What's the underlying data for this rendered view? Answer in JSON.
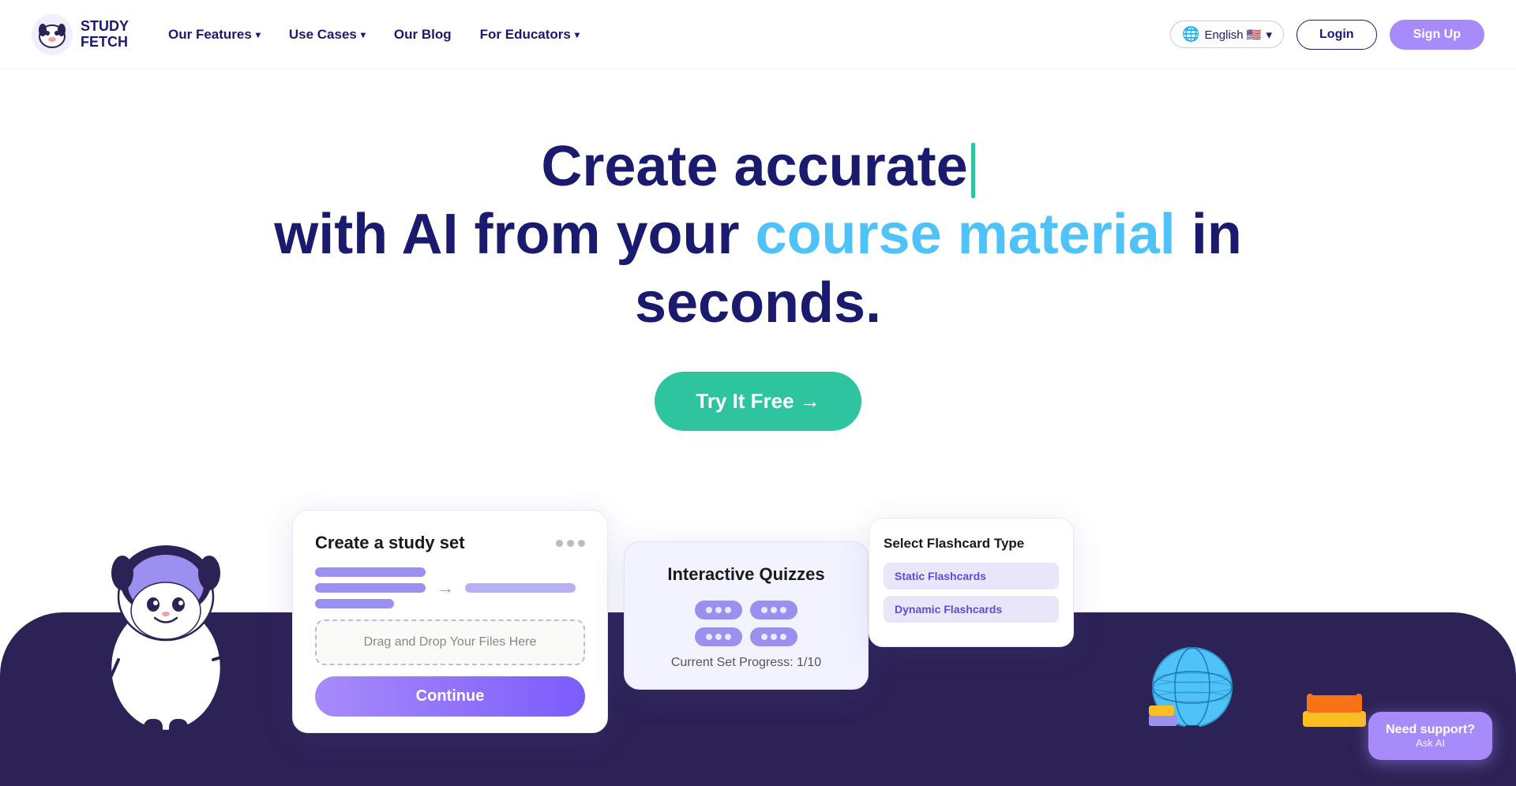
{
  "nav": {
    "logo_text_line1": "STUDY",
    "logo_text_line2": "FETCH",
    "links": [
      {
        "id": "our-features",
        "label": "Our Features",
        "has_dropdown": true
      },
      {
        "id": "use-cases",
        "label": "Use Cases",
        "has_dropdown": true
      },
      {
        "id": "our-blog",
        "label": "Our Blog",
        "has_dropdown": false
      },
      {
        "id": "for-educators",
        "label": "For Educators",
        "has_dropdown": true
      }
    ],
    "lang_label": "English 🇺🇸",
    "login_label": "Login",
    "signup_label": "Sign Up"
  },
  "hero": {
    "title_line1": "Create accurate",
    "title_line2_prefix": "with AI from your",
    "title_line2_highlight": "course material",
    "title_line2_suffix": "in",
    "title_line3": "seconds.",
    "cta_label": "Try It Free →"
  },
  "card_study_set": {
    "title": "Create a study set",
    "drop_zone_label": "Drag and Drop Your Files Here",
    "continue_label": "Continue"
  },
  "card_quiz": {
    "title": "Interactive Quizzes",
    "progress_label": "Current Set Progress:",
    "progress_value": "1/10"
  },
  "card_flashcard": {
    "title": "Select Flashcard Type",
    "option1": "Static Flashcards",
    "option2": "Dynamic Flashcards"
  },
  "support": {
    "main_label": "Need support?",
    "sub_label": "Ask AI"
  }
}
